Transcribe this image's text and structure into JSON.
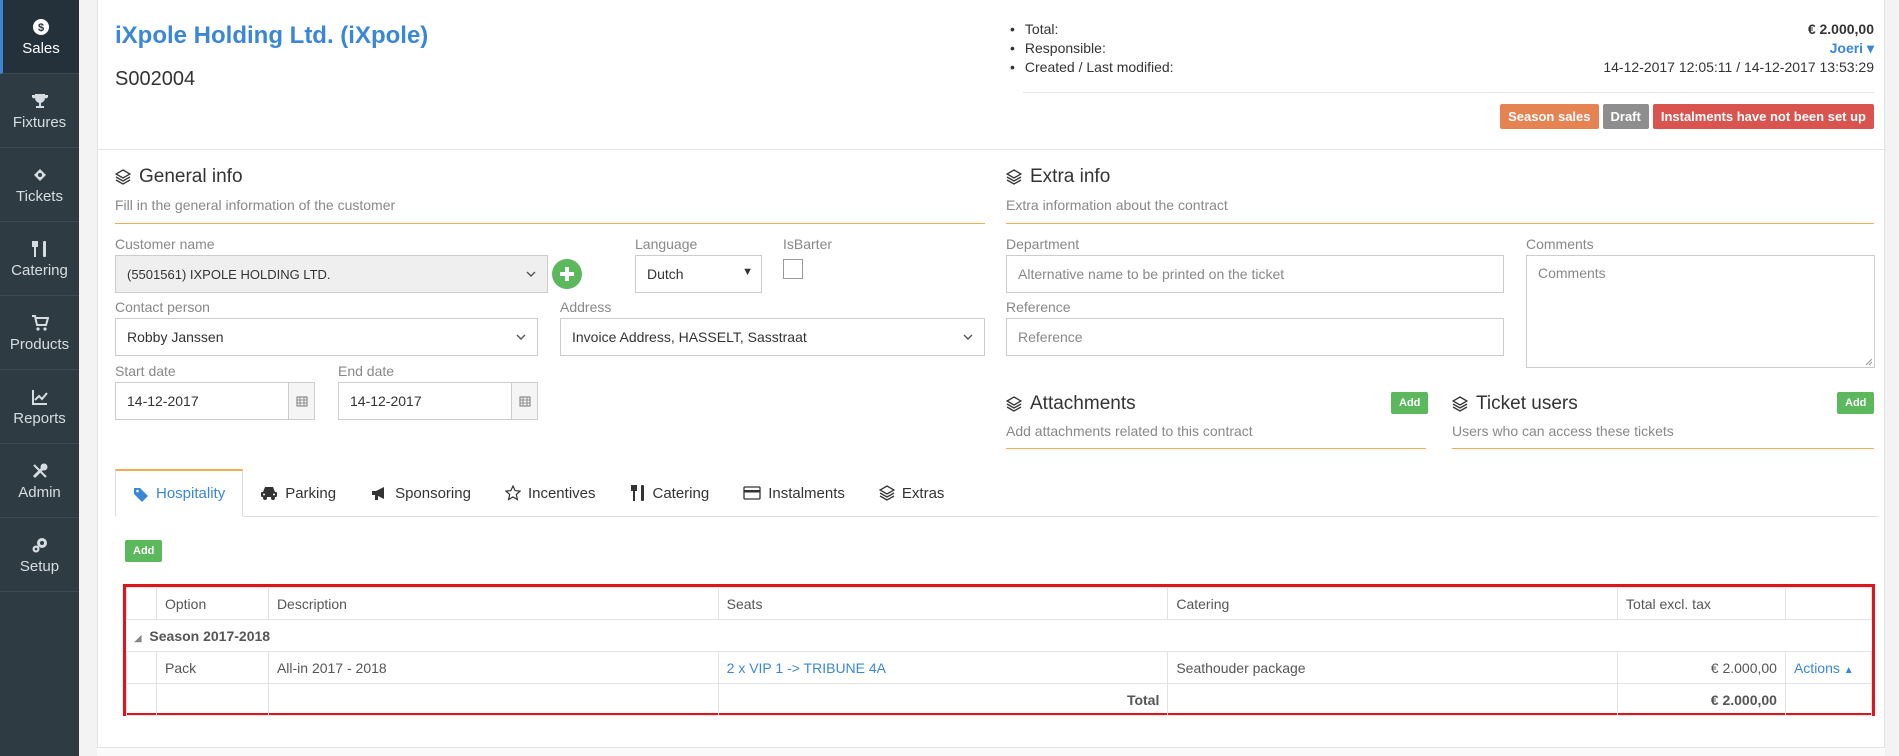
{
  "sidebar": {
    "items": [
      {
        "label": "Sales",
        "icon": "dollar-icon"
      },
      {
        "label": "Fixtures",
        "icon": "trophy-icon"
      },
      {
        "label": "Tickets",
        "icon": "ticket-icon"
      },
      {
        "label": "Catering",
        "icon": "cutlery-icon"
      },
      {
        "label": "Products",
        "icon": "cart-icon"
      },
      {
        "label": "Reports",
        "icon": "chart-icon"
      },
      {
        "label": "Admin",
        "icon": "tools-icon"
      },
      {
        "label": "Setup",
        "icon": "gears-icon"
      }
    ]
  },
  "header": {
    "company": "iXpole Holding Ltd. (iXpole)",
    "order_no": "S002004",
    "summary": {
      "total_label": "Total:",
      "total_value": "€ 2.000,00",
      "responsible_label": "Responsible:",
      "responsible_value": "Joeri",
      "created_label": "Created / Last modified:",
      "created_value": "14-12-2017 12:05:11 / 14-12-2017 13:53:29"
    },
    "badges": [
      "Season sales",
      "Draft",
      "Instalments have not been set up"
    ]
  },
  "general": {
    "title": "General info",
    "subtitle": "Fill in the general information of the customer",
    "customer_label": "Customer name",
    "customer_value": "(5501561) IXPOLE HOLDING LTD.",
    "language_label": "Language",
    "language_value": "Dutch",
    "isbarter_label": "IsBarter",
    "contact_label": "Contact person",
    "contact_value": "Robby Janssen",
    "address_label": "Address",
    "address_value": "Invoice Address, HASSELT, Sasstraat",
    "start_label": "Start date",
    "start_value": "14-12-2017",
    "end_label": "End date",
    "end_value": "14-12-2017"
  },
  "extra": {
    "title": "Extra info",
    "subtitle": "Extra information about the contract",
    "department_label": "Department",
    "department_placeholder": "Alternative name to be printed on the ticket",
    "comments_label": "Comments",
    "comments_placeholder": "Comments",
    "reference_label": "Reference",
    "reference_placeholder": "Reference"
  },
  "attachments": {
    "title": "Attachments",
    "subtitle": "Add attachments related to this contract",
    "add": "Add"
  },
  "ticket_users": {
    "title": "Ticket users",
    "subtitle": "Users who can access these tickets",
    "add": "Add"
  },
  "tabs": [
    "Hospitality",
    "Parking",
    "Sponsoring",
    "Incentives",
    "Catering",
    "Instalments",
    "Extras"
  ],
  "hospitality": {
    "add": "Add",
    "columns": [
      "Option",
      "Description",
      "Seats",
      "Catering",
      "Total excl. tax"
    ],
    "group": "Season 2017-2018",
    "row": {
      "option": "Pack",
      "description": "All-in 2017 - 2018",
      "seats": "2 x VIP 1 -> TRIBUNE 4A",
      "catering": "Seathouder package",
      "total": "€ 2.000,00",
      "actions": "Actions"
    },
    "total_label": "Total",
    "total_value": "€ 2.000,00"
  }
}
